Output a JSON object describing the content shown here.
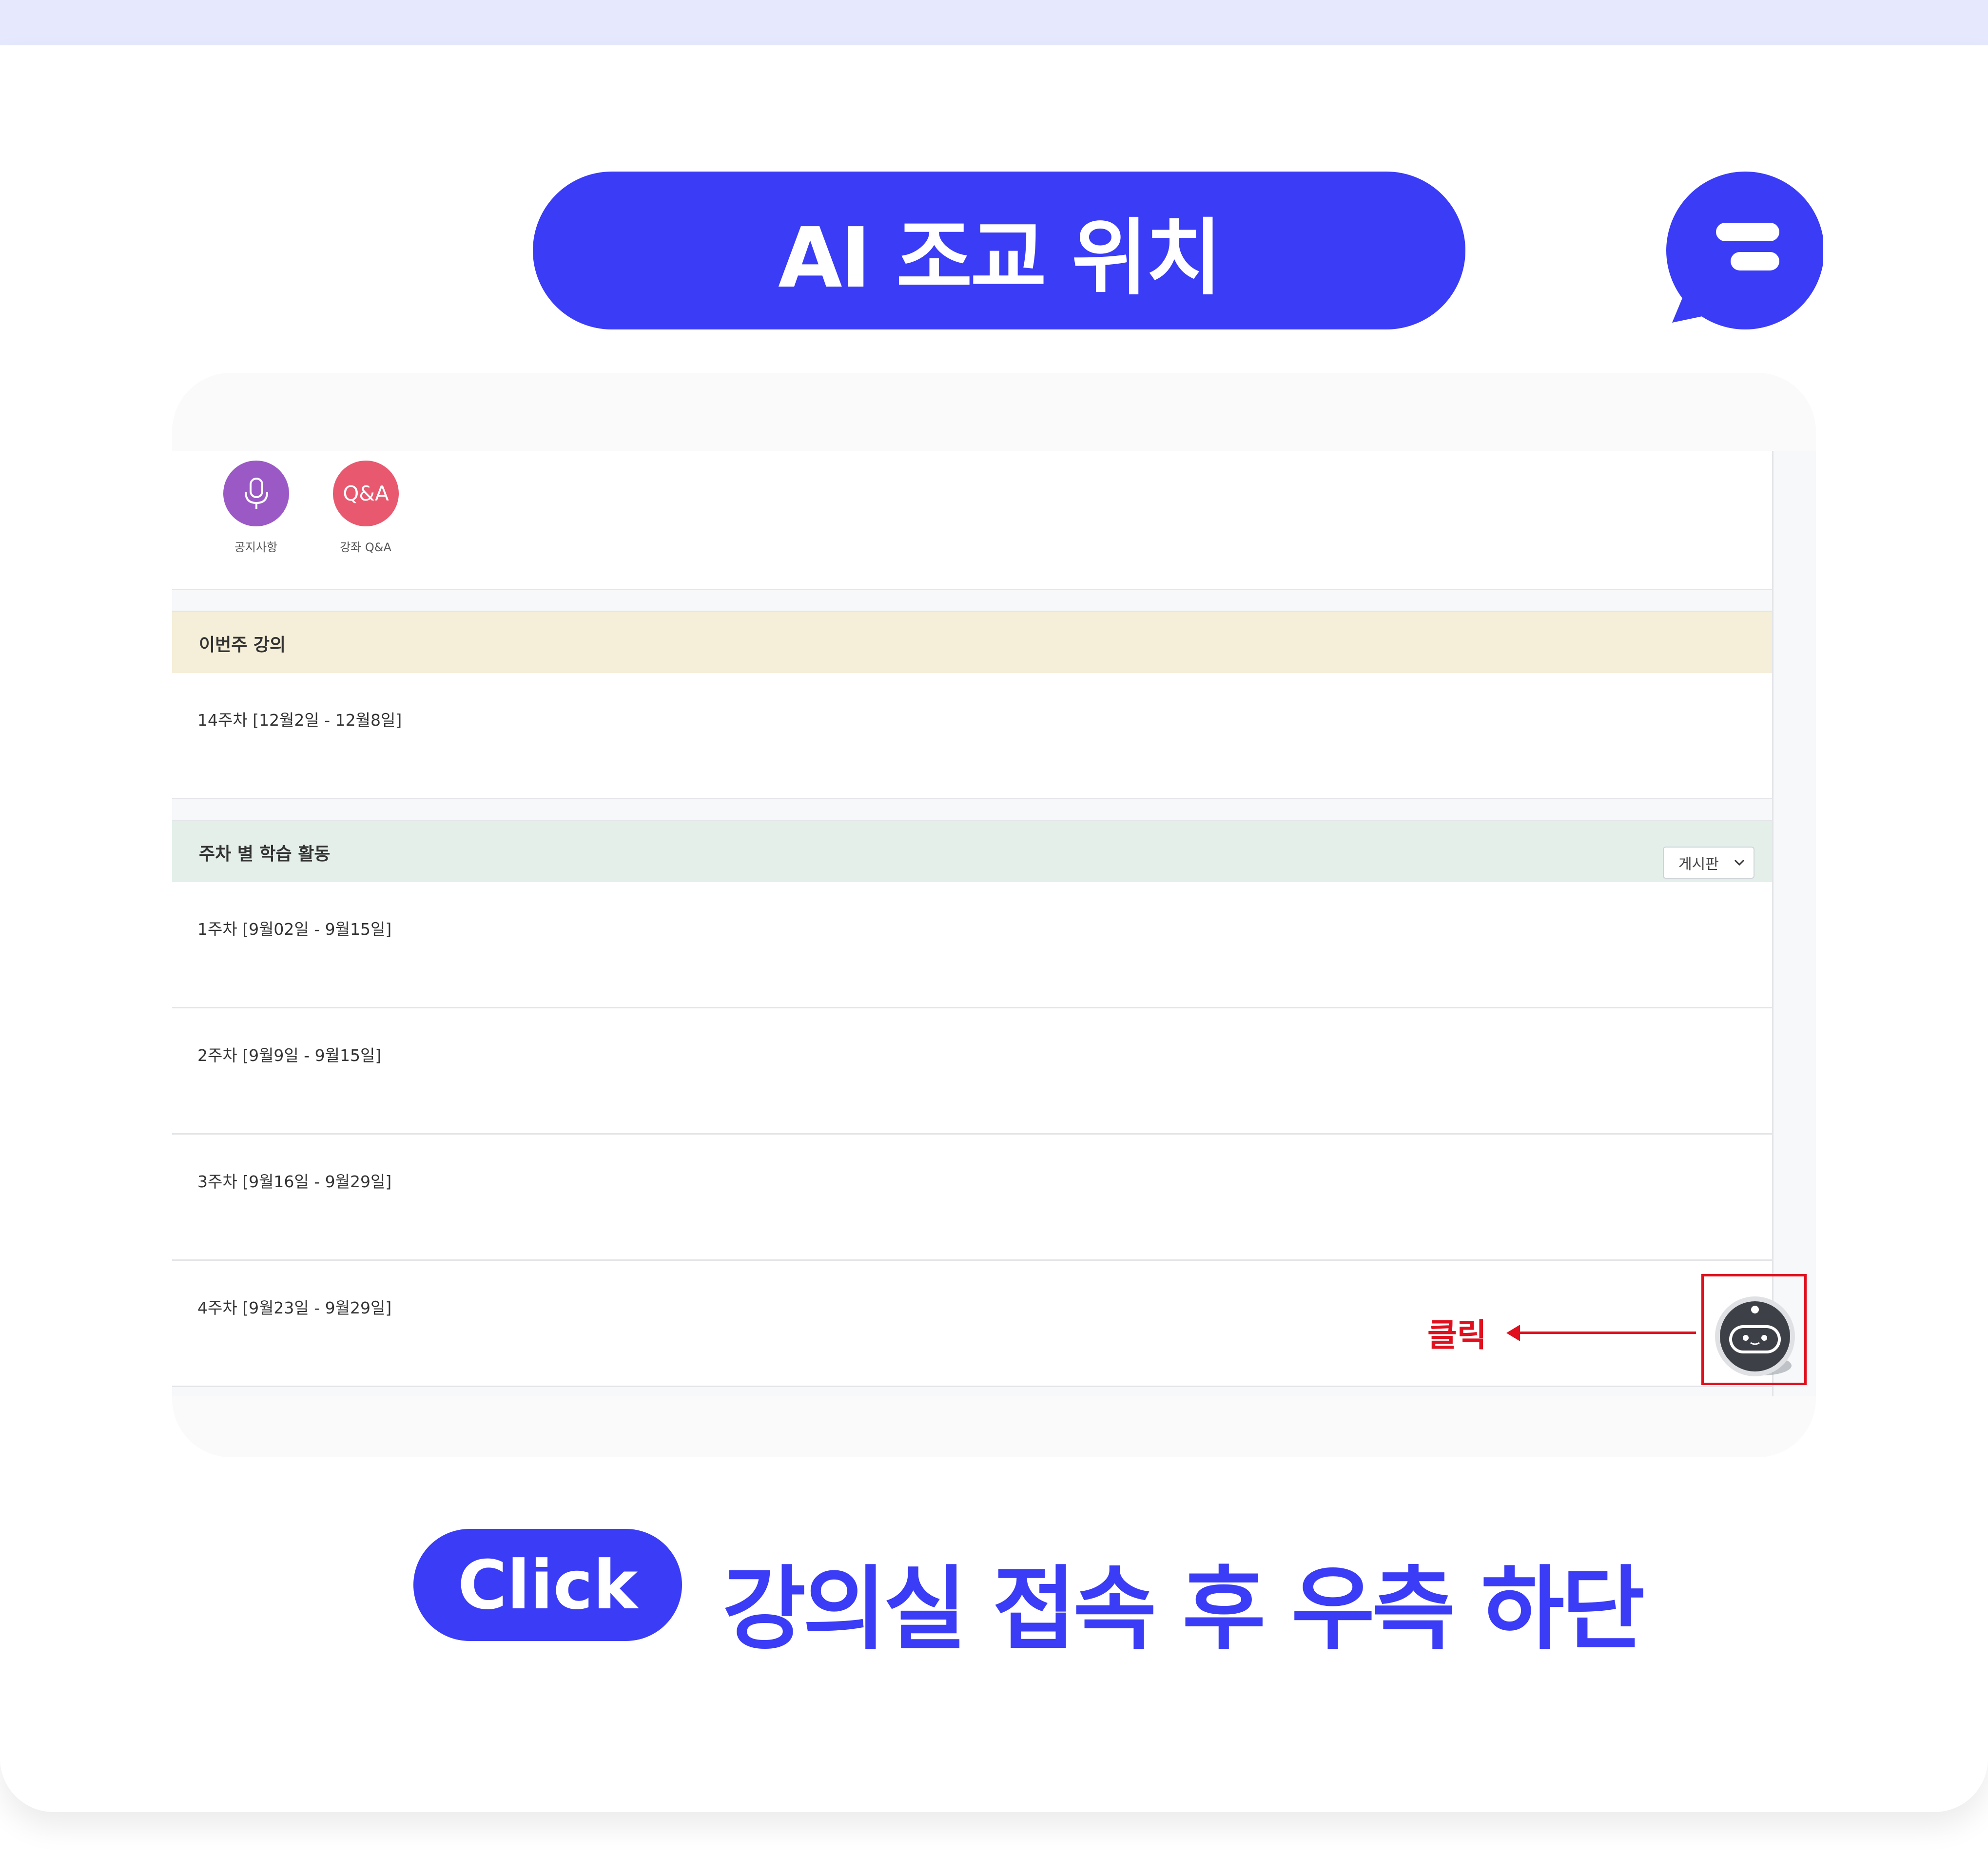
{
  "header": {
    "title": "AI 조교 위치"
  },
  "course_page": {
    "quick_icons": [
      {
        "icon": "microphone-icon",
        "label": "공지사항",
        "color": "#9b59c6"
      },
      {
        "icon": "qa-icon",
        "text": "Q&A",
        "label": "강좌 Q&A",
        "color": "#e8596f"
      }
    ],
    "this_week": {
      "title": "이번주 강의",
      "items": [
        "14주차 [12월2일 - 12월8일]"
      ],
      "header_color": "#f5eed8"
    },
    "weekly": {
      "title": "주차 별 학습 활동",
      "filter_value": "게시판",
      "header_color": "#e4efea",
      "items": [
        "1주차 [9월02일 - 9월15일]",
        "2주차 [9월9일 - 9월15일]",
        "3주차 [9월16일 - 9월29일]",
        "4주차 [9월23일 - 9월29일]"
      ]
    }
  },
  "annotation": {
    "label": "클릭",
    "target_icon": "ai-robot-icon",
    "color": "#e0101e"
  },
  "footer": {
    "button_label": "Click",
    "caption": "강의실 접속 후 우측 하단"
  },
  "colors": {
    "accent": "#3b3cf5",
    "top_band": "#e6e8fd"
  }
}
